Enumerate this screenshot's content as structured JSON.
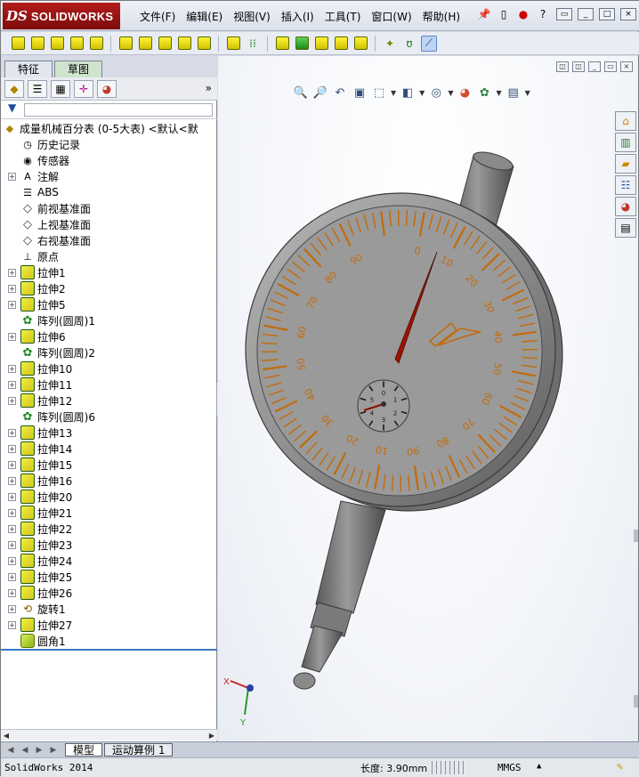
{
  "app": {
    "logo_ds": "DS",
    "logo_text": "SOLIDWORKS",
    "menu": [
      "文件(F)",
      "编辑(E)",
      "视图(V)",
      "插入(I)",
      "工具(T)",
      "窗口(W)",
      "帮助(H)"
    ]
  },
  "left_panel": {
    "tabs": [
      "特征",
      "草图"
    ],
    "active_tab": "草图",
    "more": "»",
    "root": "成量机械百分表 (0-5大表)  <默认<默",
    "items": [
      {
        "label": "历史记录",
        "icon": "history-icon",
        "expander": false
      },
      {
        "label": "传感器",
        "icon": "sensor-icon",
        "expander": false
      },
      {
        "label": "注解",
        "icon": "annotation-icon",
        "expander": true
      },
      {
        "label": "ABS",
        "icon": "material-icon",
        "expander": false
      },
      {
        "label": "前视基准面",
        "icon": "plane-icon",
        "expander": false
      },
      {
        "label": "上视基准面",
        "icon": "plane-icon",
        "expander": false
      },
      {
        "label": "右视基准面",
        "icon": "plane-icon",
        "expander": false
      },
      {
        "label": "原点",
        "icon": "origin-icon",
        "expander": false
      },
      {
        "label": "拉伸1",
        "icon": "extrude-icon",
        "expander": true
      },
      {
        "label": "拉伸2",
        "icon": "extrude-icon",
        "expander": true
      },
      {
        "label": "拉伸5",
        "icon": "extrude-icon",
        "expander": true
      },
      {
        "label": "阵列(圆周)1",
        "icon": "circular-pattern-icon",
        "expander": false
      },
      {
        "label": "拉伸6",
        "icon": "extrude-icon",
        "expander": true
      },
      {
        "label": "阵列(圆周)2",
        "icon": "circular-pattern-icon",
        "expander": false
      },
      {
        "label": "拉伸10",
        "icon": "extrude-icon",
        "expander": true
      },
      {
        "label": "拉伸11",
        "icon": "extrude-icon",
        "expander": true
      },
      {
        "label": "拉伸12",
        "icon": "extrude-icon",
        "expander": true
      },
      {
        "label": "阵列(圆周)6",
        "icon": "circular-pattern-icon",
        "expander": false
      },
      {
        "label": "拉伸13",
        "icon": "extrude-icon",
        "expander": true
      },
      {
        "label": "拉伸14",
        "icon": "extrude-icon",
        "expander": true
      },
      {
        "label": "拉伸15",
        "icon": "extrude-icon",
        "expander": true
      },
      {
        "label": "拉伸16",
        "icon": "extrude-icon",
        "expander": true
      },
      {
        "label": "拉伸20",
        "icon": "extrude-icon",
        "expander": true
      },
      {
        "label": "拉伸21",
        "icon": "extrude-icon",
        "expander": true
      },
      {
        "label": "拉伸22",
        "icon": "extrude-icon",
        "expander": true
      },
      {
        "label": "拉伸23",
        "icon": "extrude-icon",
        "expander": true
      },
      {
        "label": "拉伸24",
        "icon": "extrude-icon",
        "expander": true
      },
      {
        "label": "拉伸25",
        "icon": "extrude-icon",
        "expander": true
      },
      {
        "label": "拉伸26",
        "icon": "extrude-icon",
        "expander": true
      },
      {
        "label": "旋转1",
        "icon": "revolve-icon",
        "expander": true
      },
      {
        "label": "拉伸27",
        "icon": "extrude-icon",
        "expander": true
      },
      {
        "label": "圆角1",
        "icon": "fillet-icon",
        "expander": false
      }
    ]
  },
  "bottom_tabs": [
    "模型",
    "运动算例 1"
  ],
  "status": {
    "app": "SolidWorks 2014",
    "length": "长度: 3.90mm",
    "units": "MMGS",
    "units_arrow": "▲"
  },
  "dial": {
    "scale_labels": [
      "0",
      "10",
      "20",
      "30",
      "40",
      "50",
      "60",
      "70",
      "80",
      "90",
      "10",
      "20",
      "30",
      "40",
      "50",
      "60",
      "70",
      "80",
      "90"
    ],
    "small_labels": [
      "0",
      "1",
      "2",
      "3",
      "4",
      "5"
    ],
    "colors": {
      "face": "#9a9a9a",
      "rim": "#7d7d7d",
      "ticks": "#c26b0a",
      "needle": "#9c1300"
    }
  },
  "triad": {
    "x": "X",
    "y": "Y"
  }
}
